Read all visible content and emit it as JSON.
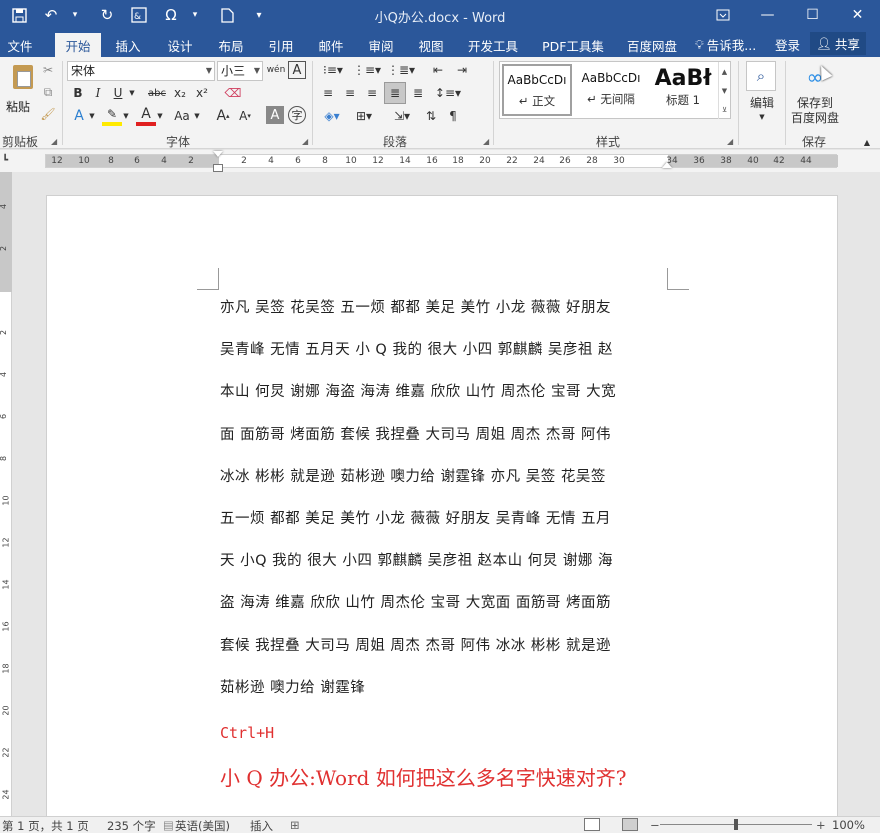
{
  "window": {
    "title": "小Q办公.docx - Word",
    "controls": [
      "—",
      "☐",
      "✕"
    ]
  },
  "qat": [
    "save-icon",
    "undo-icon",
    "redo-icon",
    "special-chars-icon",
    "symbol-icon",
    "new-doc-icon",
    "customize-icon"
  ],
  "tabs": [
    {
      "label": "文件"
    },
    {
      "label": "开始"
    },
    {
      "label": "插入"
    },
    {
      "label": "设计"
    },
    {
      "label": "布局"
    },
    {
      "label": "引用"
    },
    {
      "label": "邮件"
    },
    {
      "label": "审阅"
    },
    {
      "label": "视图"
    },
    {
      "label": "开发工具"
    },
    {
      "label": "PDF工具集"
    },
    {
      "label": "百度网盘"
    }
  ],
  "tell_me": "告诉我...",
  "login": "登录",
  "share": "共享",
  "ribbon": {
    "clipboard": {
      "paste": "粘贴",
      "group": "剪贴板"
    },
    "font": {
      "family": "宋体",
      "size": "小三",
      "wen": "wén",
      "A_label": "A",
      "B": "B",
      "I": "I",
      "U": "U",
      "abc": "abc",
      "x2sub": "x₂",
      "x2sup": "x²",
      "Aa": "Aa",
      "group": "字体"
    },
    "paragraph": {
      "group": "段落"
    },
    "styles": {
      "group": "样式",
      "cards": [
        {
          "sample": "AaBbCcDı",
          "name": "↵ 正文"
        },
        {
          "sample": "AaBbCcDı",
          "name": "↵ 无间隔"
        },
        {
          "sample": "AaBł",
          "name": "标题 1"
        }
      ]
    },
    "editing": {
      "label": "编辑"
    },
    "save": {
      "label_line1": "保存到",
      "label_line2": "百度网盘",
      "group": "保存"
    }
  },
  "ruler": {
    "numbers": [
      "12",
      "10",
      "8",
      "6",
      "4",
      "2",
      "",
      "2",
      "4",
      "6",
      "8",
      "10",
      "12",
      "14",
      "16",
      "18",
      "20",
      "22",
      "24",
      "26",
      "28",
      "30",
      "",
      "34",
      "36",
      "38",
      "40",
      "42",
      "44"
    ]
  },
  "vruler": {
    "numbers": [
      "4",
      "2",
      "",
      "2",
      "4",
      "6",
      "8",
      "10",
      "12",
      "14",
      "16",
      "18",
      "20",
      "22",
      "24"
    ]
  },
  "document": {
    "lines": [
      "亦凡 吴签 花吴签 五一烦 都都 美足 美竹 小龙 薇薇 好朋友",
      "吴青峰 无情 五月天 小 Q 我的 很大 小四 郭麒麟 吴彦祖 赵",
      "本山 何炅 谢娜 海盗 海涛 维嘉 欣欣 山竹 周杰伦 宝哥 大宽",
      "面 面筋哥 烤面筋 套候 我捏叠 大司马 周姐 周杰 杰哥 阿伟",
      "冰冰 彬彬 就是逊 茹彬逊 噢力给 谢霆锋 亦凡 吴签 花吴签",
      "五一烦 都都 美足 美竹 小龙 薇薇 好朋友 吴青峰 无情 五月",
      "天 小Q 我的 很大 小四 郭麒麟 吴彦祖 赵本山 何炅 谢娜 海",
      "盗 海涛 维嘉 欣欣 山竹 周杰伦 宝哥 大宽面 面筋哥 烤面筋",
      "套候 我捏叠 大司马 周姐 周杰 杰哥 阿伟 冰冰 彬彬 就是逊",
      "茹彬逊 噢力给 谢霆锋"
    ],
    "shortcut": "Ctrl+H",
    "headline": "小 Q 办公:Word 如何把这么多名字快速对齐?",
    "accent_color": "#e03030"
  },
  "status": {
    "page": "第 1 页，共 1 页",
    "words": "235 个字",
    "language": "英语(美国)",
    "mode": "插入",
    "zoom": "100%",
    "zoom_minus": "−",
    "zoom_plus": "+"
  },
  "colors": {
    "brand": "#2b579a",
    "ribbon_bg": "#f3f3f3",
    "doc_bg": "#e6e6e6"
  }
}
